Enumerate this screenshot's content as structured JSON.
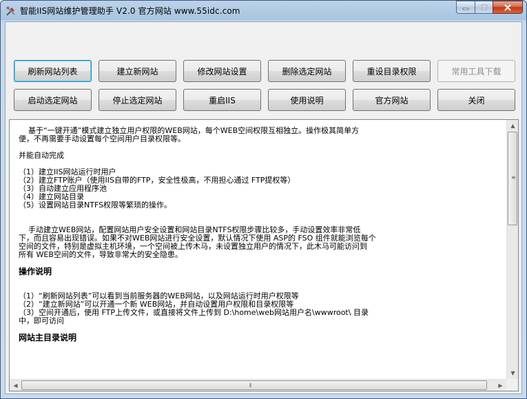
{
  "window": {
    "title": "智能IIS网站维护管理助手 V2.0 官方网站 www.55idc.com"
  },
  "toolbar": {
    "row1": [
      {
        "label": "刷新网站列表",
        "name": "refresh-sites-button",
        "state": "focused"
      },
      {
        "label": "建立新网站",
        "name": "create-site-button",
        "state": "normal"
      },
      {
        "label": "修改网站设置",
        "name": "edit-site-settings-button",
        "state": "normal"
      },
      {
        "label": "删除选定网站",
        "name": "delete-site-button",
        "state": "normal"
      },
      {
        "label": "重设目录权限",
        "name": "reset-dir-permissions-button",
        "state": "normal"
      },
      {
        "label": "常用工具下载",
        "name": "tools-download-button",
        "state": "disabled"
      }
    ],
    "row2": [
      {
        "label": "启动选定网站",
        "name": "start-site-button",
        "state": "normal"
      },
      {
        "label": "停止选定网站",
        "name": "stop-site-button",
        "state": "normal"
      },
      {
        "label": "重启IIS",
        "name": "restart-iis-button",
        "state": "normal"
      },
      {
        "label": "使用说明",
        "name": "help-button",
        "state": "normal"
      },
      {
        "label": "官方网站",
        "name": "official-site-button",
        "state": "normal"
      },
      {
        "label": "关闭",
        "name": "close-app-button",
        "state": "normal"
      }
    ]
  },
  "content": {
    "lines": [
      {
        "t": "    基于“一键开通”模式建立独立用户权限的WEB网站，每个WEB空间权限互相独立。操作极其简单方",
        "k": "text"
      },
      {
        "t": "便，不再需要手动设置每个空间用户目录权限等。",
        "k": "text"
      },
      {
        "t": "",
        "k": "blank"
      },
      {
        "t": "并能自动完成",
        "k": "text"
      },
      {
        "t": "",
        "k": "blank"
      },
      {
        "t": "（1）建立IIS网站运行时用户",
        "k": "text"
      },
      {
        "t": "（2）建立FTP账户（使用IIS自带的FTP，安全性极高，不用担心通过 FTP提权等）",
        "k": "text"
      },
      {
        "t": "（3）自动建立应用程序池",
        "k": "text"
      },
      {
        "t": "（4）建立网站目录",
        "k": "text"
      },
      {
        "t": "（5）设置网站目录NTFS权限等繁琐的操作。",
        "k": "text"
      },
      {
        "t": "",
        "k": "blank"
      },
      {
        "t": "",
        "k": "blank"
      },
      {
        "t": "    手动建立WEB网站，配置网站用户安全设置和网站目录NTFS权限步骤比较多，手动设置效率非常低",
        "k": "text"
      },
      {
        "t": "下，而且容易出现错误。如果不对WEB网站进行安全设置，默认情况下使用 ASP的 FSO 组件就能浏览每个",
        "k": "text"
      },
      {
        "t": "空间的文件，特别是虚拟主机环境，一个空间被上传木马，未设置独立用户的情况下，此木马可能访问到",
        "k": "text"
      },
      {
        "t": "所有 WEB空间的文件，导致非常大的安全隐患。",
        "k": "text"
      },
      {
        "t": "",
        "k": "blank"
      },
      {
        "t": "操作说明",
        "k": "heading"
      },
      {
        "t": "",
        "k": "blank"
      },
      {
        "t": "",
        "k": "blank"
      },
      {
        "t": "（1）“刷新网站列表”可以看到当前服务器的WEB网站，以及网站运行时用户权限等",
        "k": "text"
      },
      {
        "t": "（2）“建立新网站”可以开通一个新 WEB网站，并自动设置用户权限和目录权限等",
        "k": "text"
      },
      {
        "t": "（3）空间开通后，使用 FTP上传文件，或直接将文件上传到 D:\\home\\web网站用户名\\wwwroot\\ 目录",
        "k": "text"
      },
      {
        "t": "中，即可访问",
        "k": "text"
      },
      {
        "t": "",
        "k": "blank"
      },
      {
        "t": "网站主目录说明",
        "k": "heading"
      }
    ]
  }
}
